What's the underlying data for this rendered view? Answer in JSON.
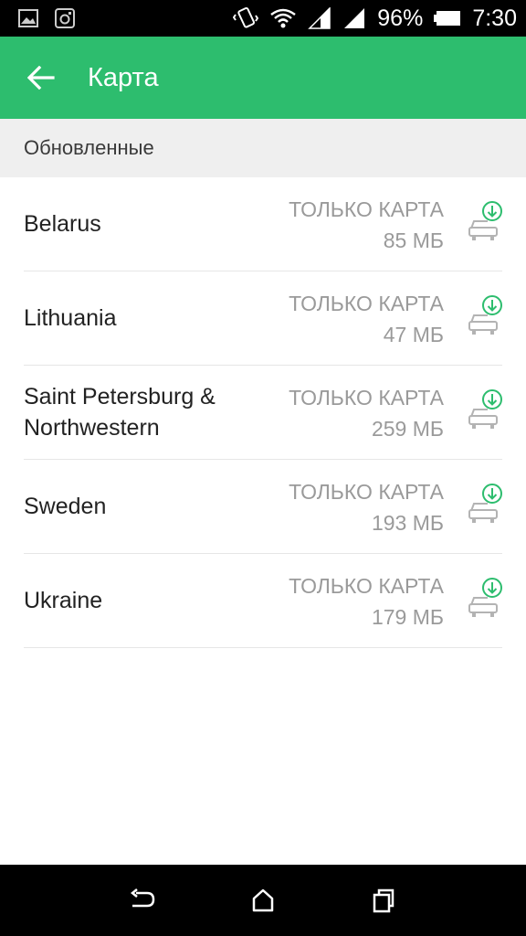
{
  "status_bar": {
    "battery": "96%",
    "time": "7:30",
    "icons": [
      "image-icon",
      "instagram-icon",
      "vibrate-icon",
      "wifi-icon",
      "signal-icon",
      "signal-icon",
      "battery-icon"
    ]
  },
  "app_bar": {
    "title": "Карта",
    "back_icon": "arrow-back-icon"
  },
  "section": {
    "header": "Обновленные"
  },
  "items": [
    {
      "name": "Belarus",
      "type": "ТОЛЬКО КАРТА",
      "size": "85 МБ"
    },
    {
      "name": "Lithuania",
      "type": "ТОЛЬКО КАРТА",
      "size": "47 МБ"
    },
    {
      "name": "Saint Petersburg & Northwestern",
      "type": "ТОЛЬКО КАРТА",
      "size": "259 МБ"
    },
    {
      "name": "Sweden",
      "type": "ТОЛЬКО КАРТА",
      "size": "193 МБ"
    },
    {
      "name": "Ukraine",
      "type": "ТОЛЬКО КАРТА",
      "size": "179 МБ"
    }
  ],
  "colors": {
    "accent": "#2dbd6e",
    "secondary_text": "#9a9a9a"
  },
  "nav_bar": {
    "icons": [
      "back-icon",
      "home-icon",
      "recents-icon"
    ]
  }
}
